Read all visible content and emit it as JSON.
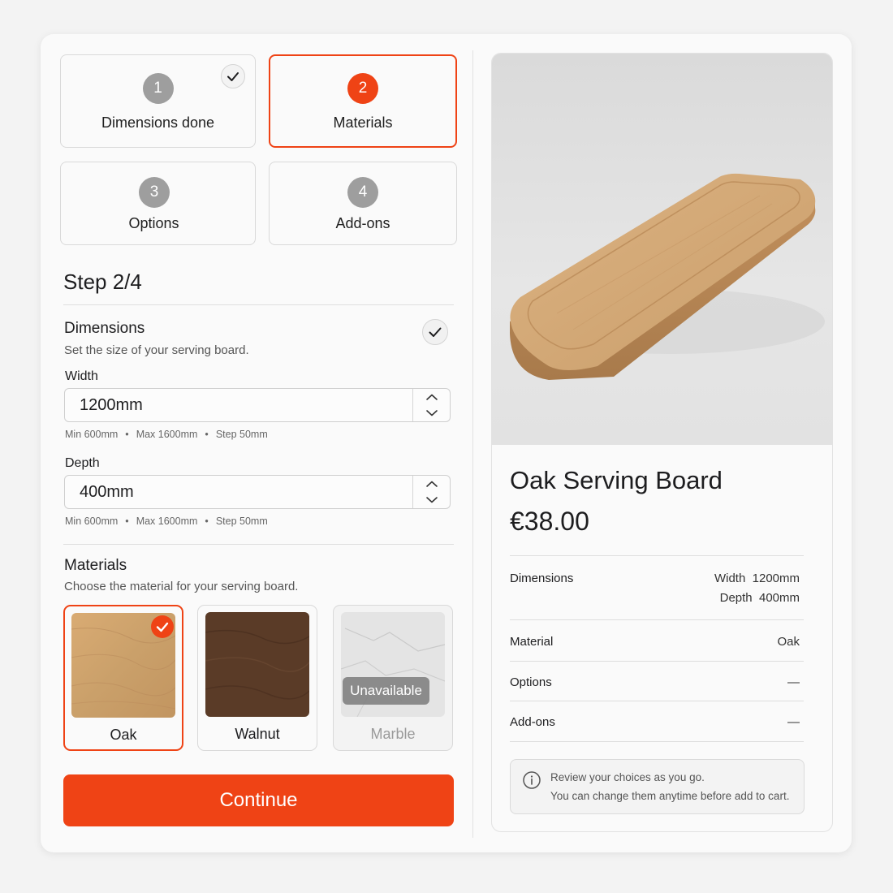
{
  "steps": [
    {
      "number": "1",
      "label": "Dimensions done",
      "state": "done"
    },
    {
      "number": "2",
      "label": "Materials",
      "state": "active"
    },
    {
      "number": "3",
      "label": "Options",
      "state": "pending"
    },
    {
      "number": "4",
      "label": "Add-ons",
      "state": "pending"
    }
  ],
  "step_heading": "Step 2/4",
  "dimensions": {
    "title": "Dimensions",
    "description": "Set the size of your serving board.",
    "width": {
      "label": "Width",
      "value": "1200mm",
      "hint_min": "Min 600mm",
      "hint_max": "Max 1600mm",
      "hint_step": "Step 50mm"
    },
    "depth": {
      "label": "Depth",
      "value": "400mm",
      "hint_min": "Min 600mm",
      "hint_max": "Max 1600mm",
      "hint_step": "Step 50mm"
    },
    "dot": "•"
  },
  "materials": {
    "title": "Materials",
    "description": "Choose the material for your serving board.",
    "items": [
      {
        "label": "Oak",
        "selected": true,
        "available": true
      },
      {
        "label": "Walnut",
        "selected": false,
        "available": true
      },
      {
        "label": "Marble",
        "selected": false,
        "available": false,
        "badge": "Unavailable"
      }
    ]
  },
  "continue_label": "Continue",
  "summary": {
    "title": "Oak Serving Board",
    "price": "€38.00",
    "rows": [
      {
        "label": "Dimensions",
        "value_line1": "Width  1200mm",
        "value_line2": "Depth  400mm"
      },
      {
        "label": "Material",
        "value": "Oak"
      },
      {
        "label": "Options",
        "value": "—"
      },
      {
        "label": "Add-ons",
        "value": "—"
      }
    ],
    "notice_line1": "Review your choices as you go.",
    "notice_line2": "You can change them anytime before add to cart."
  },
  "colors": {
    "accent": "#ef4315",
    "muted": "#9e9e9e",
    "border": "#d9d9d9"
  },
  "icons": [
    "check-icon",
    "chevron-up-icon",
    "chevron-down-icon",
    "info-icon"
  ]
}
